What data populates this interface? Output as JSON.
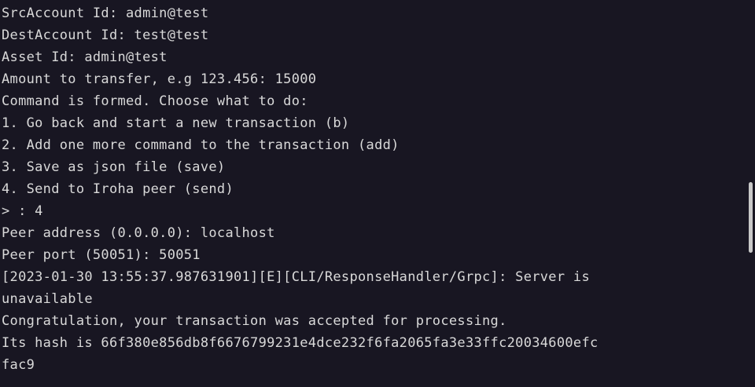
{
  "terminal": {
    "lines": [
      "SrcAccount Id: admin@test",
      "DestAccount Id: test@test",
      "Asset Id: admin@test",
      "Amount to transfer, e.g 123.456: 15000",
      "Command is formed. Choose what to do:",
      "1. Go back and start a new transaction (b)",
      "2. Add one more command to the transaction (add)",
      "3. Save as json file (save)",
      "4. Send to Iroha peer (send)",
      "> : 4",
      "Peer address (0.0.0.0): localhost",
      "Peer port (50051): 50051",
      "[2023-01-30 13:55:37.987631901][E][CLI/ResponseHandler/Grpc]: Server is",
      "unavailable",
      "Congratulation, your transaction was accepted for processing.",
      "Its hash is 66f380e856db8f6676799231e4dce232f6fa2065fa3e33ffc20034600efc",
      "fac9"
    ]
  }
}
